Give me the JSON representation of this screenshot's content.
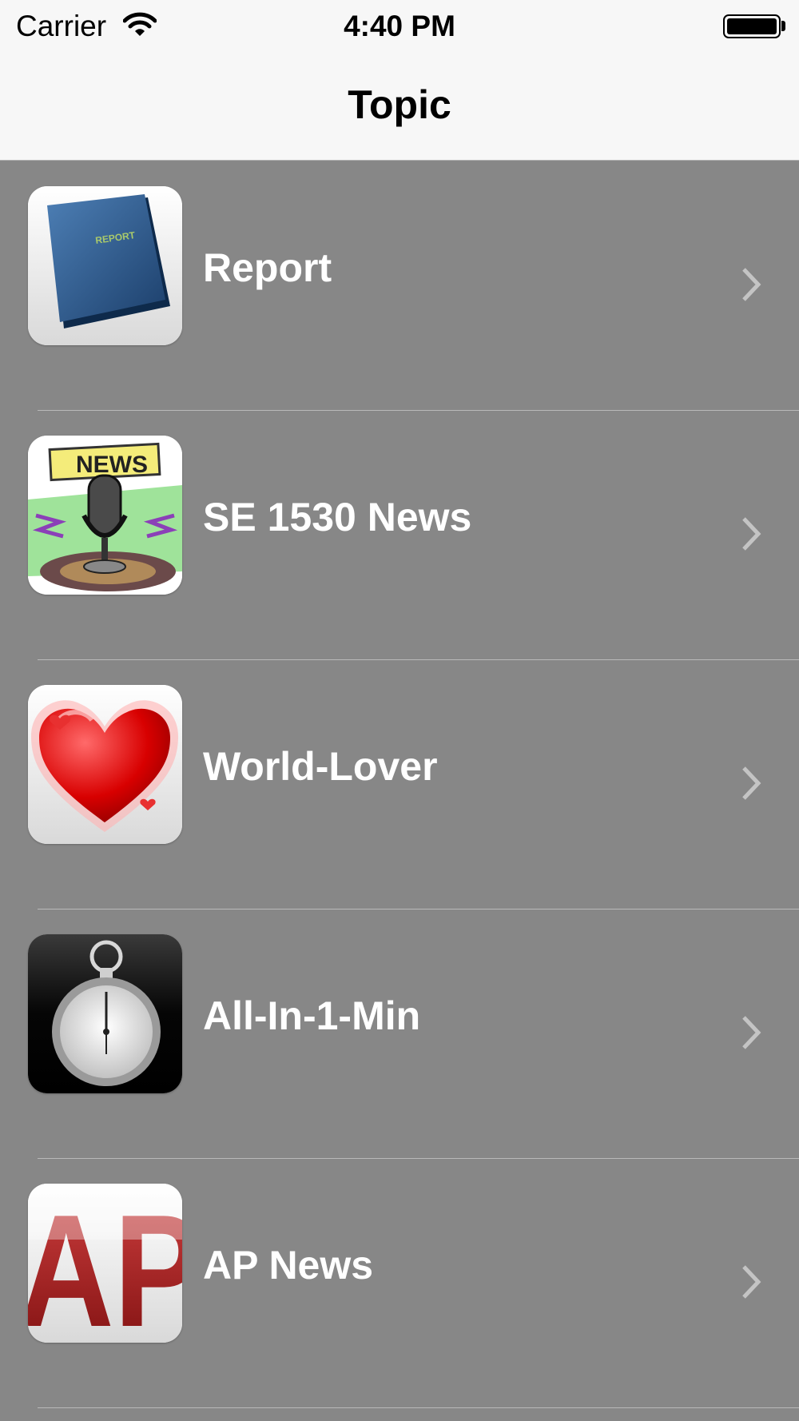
{
  "status_bar": {
    "carrier": "Carrier",
    "time": "4:40 PM",
    "wifi_icon": "wifi-icon",
    "battery_icon": "battery-full-icon"
  },
  "nav": {
    "title": "Topic"
  },
  "topics": [
    {
      "label": "Report",
      "icon": "report-book-icon",
      "icon_text": "REPORT"
    },
    {
      "label": "SE 1530 News",
      "icon": "news-microphone-icon",
      "icon_text": "NEWS"
    },
    {
      "label": "World-Lover",
      "icon": "heart-icon"
    },
    {
      "label": "All-In-1-Min",
      "icon": "stopwatch-icon"
    },
    {
      "label": "AP News",
      "icon": "ap-logo-icon",
      "icon_text": "AP"
    }
  ],
  "colors": {
    "bar_background": "#f7f7f7",
    "list_background": "#878787",
    "row_text": "#ffffff",
    "separator": "#b9b9b9",
    "chevron": "#c4c4c4"
  }
}
